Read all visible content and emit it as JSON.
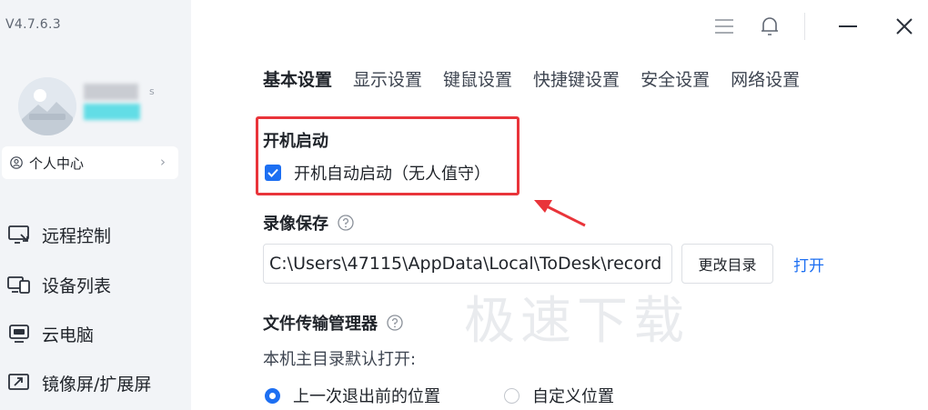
{
  "app": {
    "version": "V4.7.6.3"
  },
  "user": {
    "name_fragment": "s"
  },
  "sidebar": {
    "user_center_label": "个人中心",
    "items": [
      {
        "label": "远程控制",
        "icon": "remote-control-icon"
      },
      {
        "label": "设备列表",
        "icon": "device-list-icon"
      },
      {
        "label": "云电脑",
        "icon": "cloud-pc-icon"
      },
      {
        "label": "镜像屏/扩展屏",
        "icon": "mirror-screen-icon"
      }
    ]
  },
  "tabs": [
    {
      "label": "基本设置",
      "active": true
    },
    {
      "label": "显示设置",
      "active": false
    },
    {
      "label": "键鼠设置",
      "active": false
    },
    {
      "label": "快捷键设置",
      "active": false
    },
    {
      "label": "安全设置",
      "active": false
    },
    {
      "label": "网络设置",
      "active": false
    }
  ],
  "startup": {
    "title": "开机启动",
    "checkbox_label": "开机自动启动（无人值守）",
    "checked": true
  },
  "recording": {
    "title": "录像保存",
    "path": "C:\\Users\\47115\\AppData\\Local\\ToDesk\\record",
    "change_dir_label": "更改目录",
    "open_label": "打开"
  },
  "file_transfer": {
    "title": "文件传输管理器",
    "default_dir_label": "本机主目录默认打开:",
    "options": [
      {
        "label": "上一次退出前的位置",
        "selected": true
      },
      {
        "label": "自定义位置",
        "selected": false
      }
    ]
  },
  "watermark": "极速下载",
  "colors": {
    "accent": "#1d6ff2",
    "highlight": "#e9343a",
    "sidebar_bg": "#f2f4f7"
  }
}
